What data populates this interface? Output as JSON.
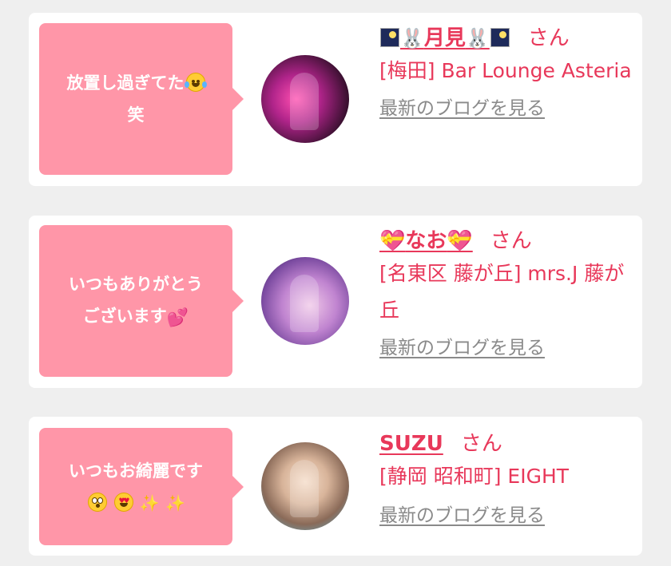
{
  "cards": [
    {
      "message": "放置し過ぎてた",
      "message_line2": "笑",
      "message_emoji": "face-with-tears-of-joy",
      "name": "月見",
      "name_prefix_icons": [
        "night-tile-icon",
        "bunny-icon"
      ],
      "name_suffix_icons": [
        "bunny-icon",
        "night-tile-icon"
      ],
      "honorific": "さん",
      "shop": "[梅田] Bar Lounge Asteria",
      "blog_link": "最新のブログを見る"
    },
    {
      "message": "いつもありがとう",
      "message_line2": "ございます",
      "message_emoji": "two-hearts",
      "name": "なお",
      "name_prefix_icons": [
        "heart-with-ribbon-icon"
      ],
      "name_suffix_icons": [
        "heart-with-ribbon-icon"
      ],
      "honorific": "さん",
      "shop": "[名東区 藤が丘] mrs.J 藤が丘",
      "blog_link": "最新のブログを見る"
    },
    {
      "message": "いつもお綺麗です",
      "message_emoji": [
        "flushed-face",
        "heart-eyes-face",
        "sparkles",
        "sparkles"
      ],
      "name": "SUZU",
      "honorific": "さん",
      "shop": "[静岡 昭和町] EIGHT",
      "blog_link": "最新のブログを見る"
    }
  ],
  "colors": {
    "background": "#efefef",
    "card": "#ffffff",
    "bubble": "#ff96a8",
    "accent_text": "#e8385a",
    "link_gray": "#8a8a8a"
  }
}
